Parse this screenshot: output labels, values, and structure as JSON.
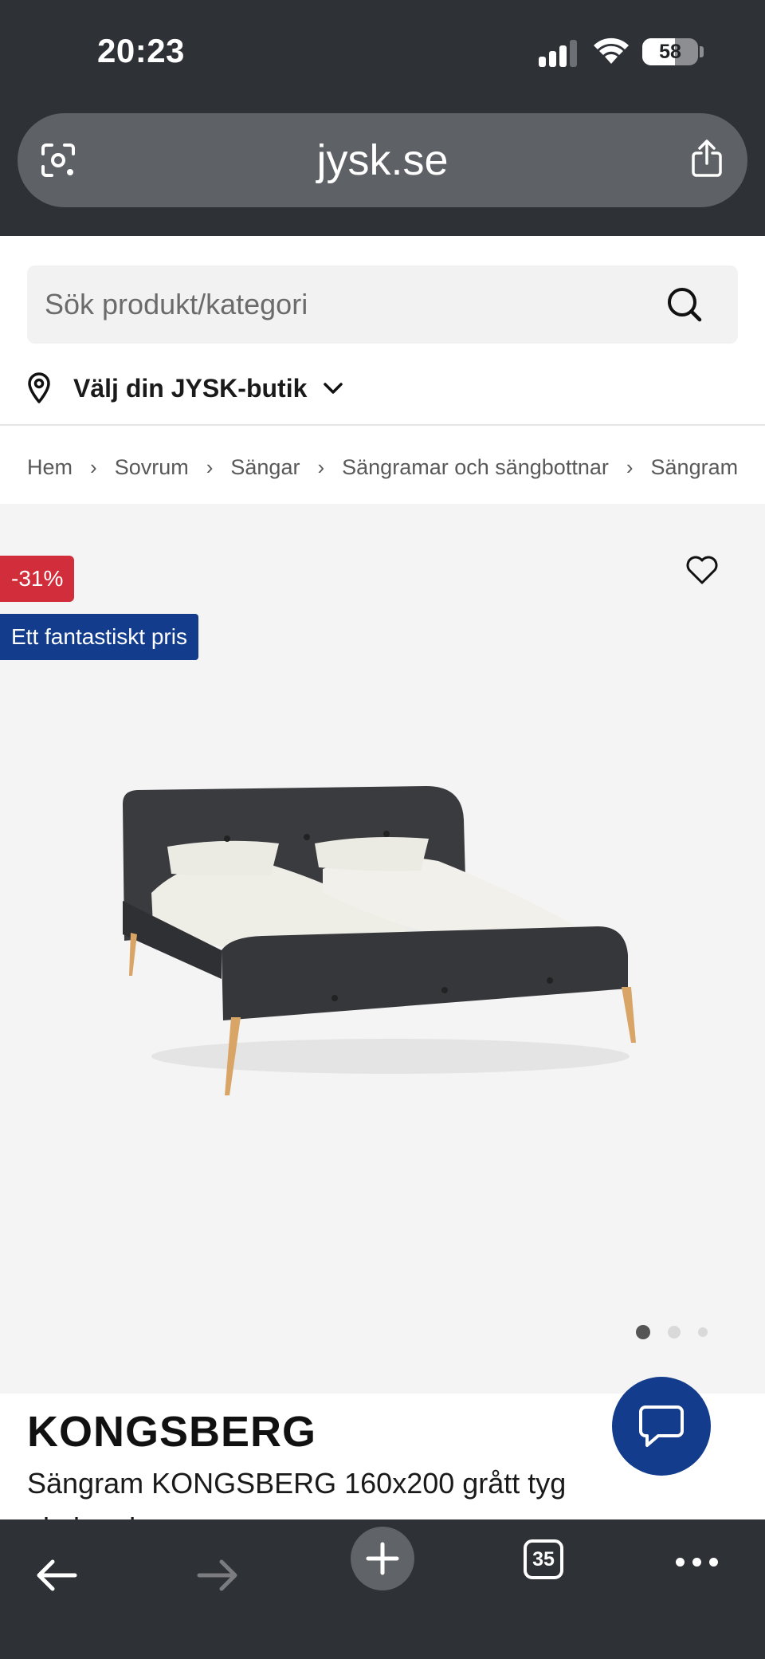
{
  "status_bar": {
    "time": "20:23",
    "battery_percent": "58",
    "signal_bars": 3
  },
  "browser": {
    "url": "jysk.se",
    "open_tabs_count": "35"
  },
  "search": {
    "placeholder": "Sök produkt/kategori"
  },
  "store_selector": {
    "label": "Välj din JYSK-butik"
  },
  "breadcrumb": {
    "items": [
      "Hem",
      "Sovrum",
      "Sängar",
      "Sängramar och sängbottnar",
      "Sängram"
    ],
    "separator": "›"
  },
  "product": {
    "discount_badge": "-31%",
    "offer_badge": "Ett fantastiskt pris",
    "brand": "KONGSBERG",
    "name": "Sängram KONGSBERG 160x200 grått tyg",
    "name_line2": "ekeben ben",
    "image_count": 3,
    "active_image_index": 1
  },
  "colors": {
    "browser_chrome": "#2e3135",
    "url_bar": "#5e6165",
    "discount_red": "#d12d3a",
    "jysk_blue": "#143c8c",
    "gallery_bg": "#f4f4f4"
  }
}
